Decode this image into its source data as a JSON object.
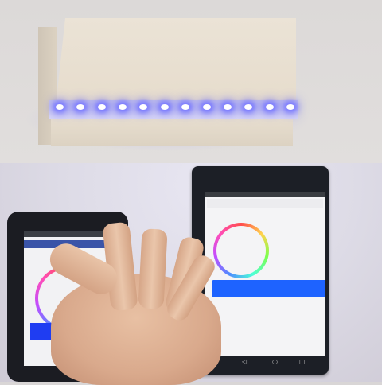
{
  "scene": {
    "led_color": "#7b7bff",
    "tablet_button_color": "#1e63ff",
    "phone_button_color": "#1f3df2",
    "led_count": 12
  }
}
